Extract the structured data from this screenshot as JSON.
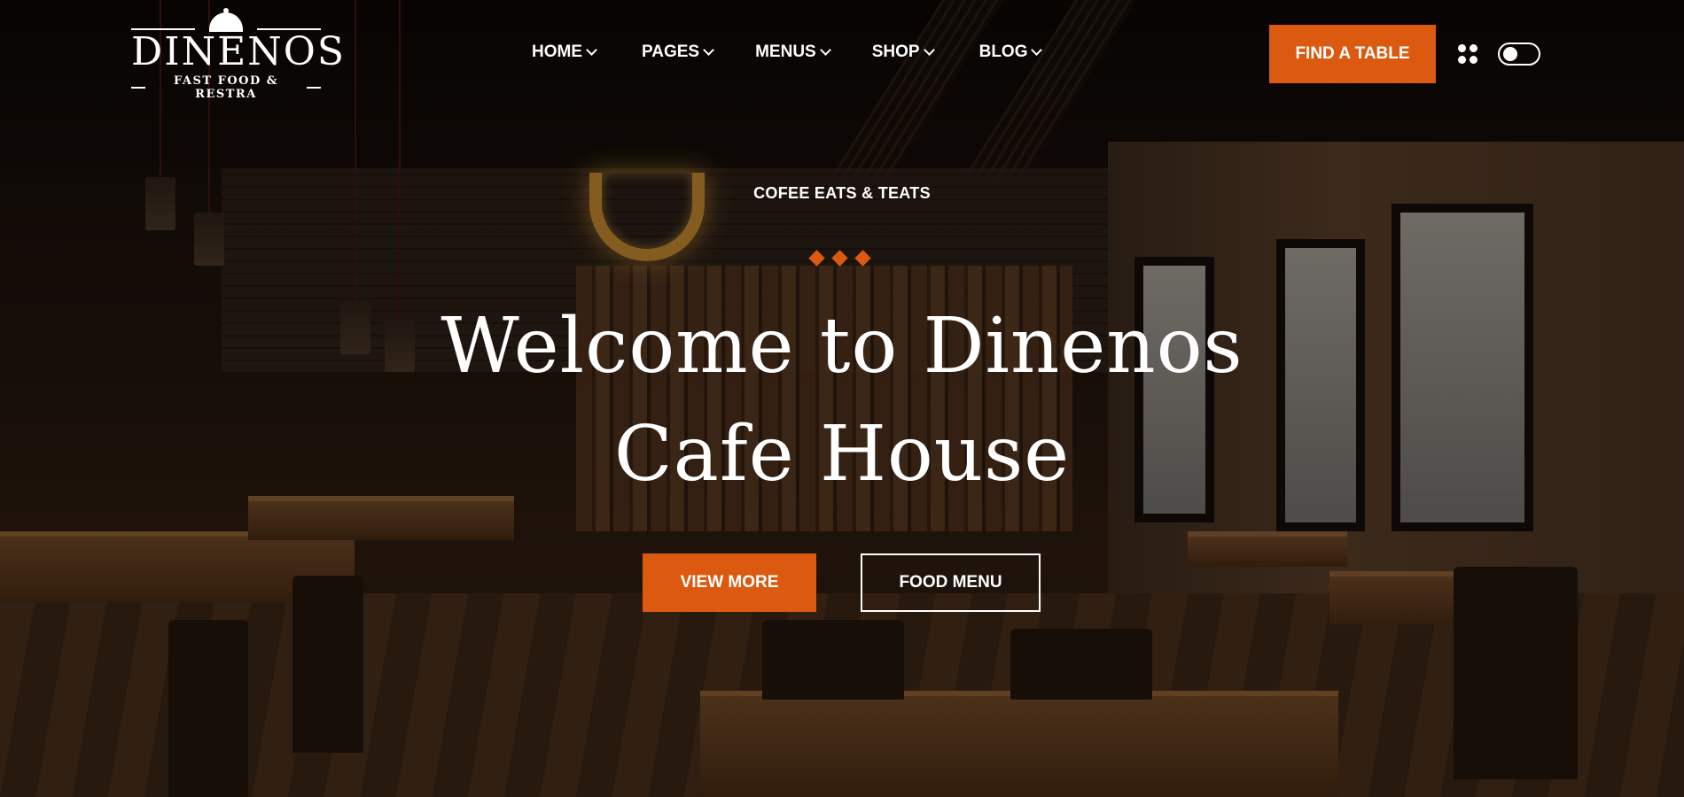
{
  "brand": {
    "name": "DINENOS",
    "tagline": "FAST FOOD & RESTRA"
  },
  "nav": {
    "items": [
      {
        "label": "HOME"
      },
      {
        "label": "PAGES"
      },
      {
        "label": "MENUS"
      },
      {
        "label": "SHOP"
      },
      {
        "label": "BLOG"
      }
    ]
  },
  "header": {
    "cta_label": "FIND A TABLE",
    "menu_icon": "grid-dots-icon",
    "toggle_icon": "theme-toggle"
  },
  "hero": {
    "kicker": "COFEE EATS & TEATS",
    "title_line1": "Welcome to Dinenos",
    "title_line2": "Cafe House",
    "primary_button": "VIEW MORE",
    "secondary_button": "FOOD MENU"
  },
  "colors": {
    "accent": "#dc5a10",
    "text": "#ffffff"
  }
}
